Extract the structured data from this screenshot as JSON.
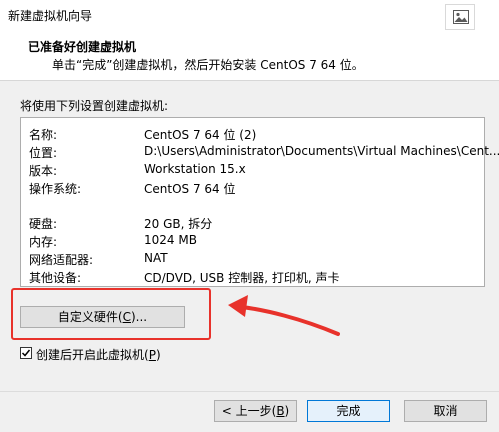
{
  "window": {
    "title": "新建虚拟机向导"
  },
  "header": {
    "title": "已准备好创建虚拟机",
    "subtitle": "单击“完成”创建虚拟机，然后开始安装 CentOS 7 64 位。"
  },
  "intro": "将使用下列设置创建虚拟机:",
  "summary": [
    {
      "label": "名称:",
      "value": "CentOS 7 64 位 (2)"
    },
    {
      "label": "位置:",
      "value": "D:\\Users\\Administrator\\Documents\\Virtual Machines\\Cent..."
    },
    {
      "label": "版本:",
      "value": "Workstation 15.x"
    },
    {
      "label": "操作系统:",
      "value": "CentOS 7 64 位"
    },
    {
      "label": "硬盘:",
      "value": "20 GB, 拆分"
    },
    {
      "label": "内存:",
      "value": "1024 MB"
    },
    {
      "label": "网络适配器:",
      "value": "NAT"
    },
    {
      "label": "其他设备:",
      "value": "CD/DVD, USB 控制器, 打印机, 声卡"
    }
  ],
  "buttons": {
    "customize_prefix": "自定义硬件(",
    "customize_key": "C",
    "customize_suffix": ")...",
    "back_prefix": "< 上一步(",
    "back_key": "B",
    "back_suffix": ")",
    "finish": "完成",
    "cancel": "取消"
  },
  "checkbox": {
    "checked": true,
    "label_prefix": "创建后开启此虚拟机(",
    "label_key": "P",
    "label_suffix": ")"
  },
  "annotation": {
    "color": "#e8322b"
  },
  "icons": {
    "title_icon": "picture-icon",
    "checkbox": "checkmark-icon",
    "annotation": "arrow-icon"
  }
}
